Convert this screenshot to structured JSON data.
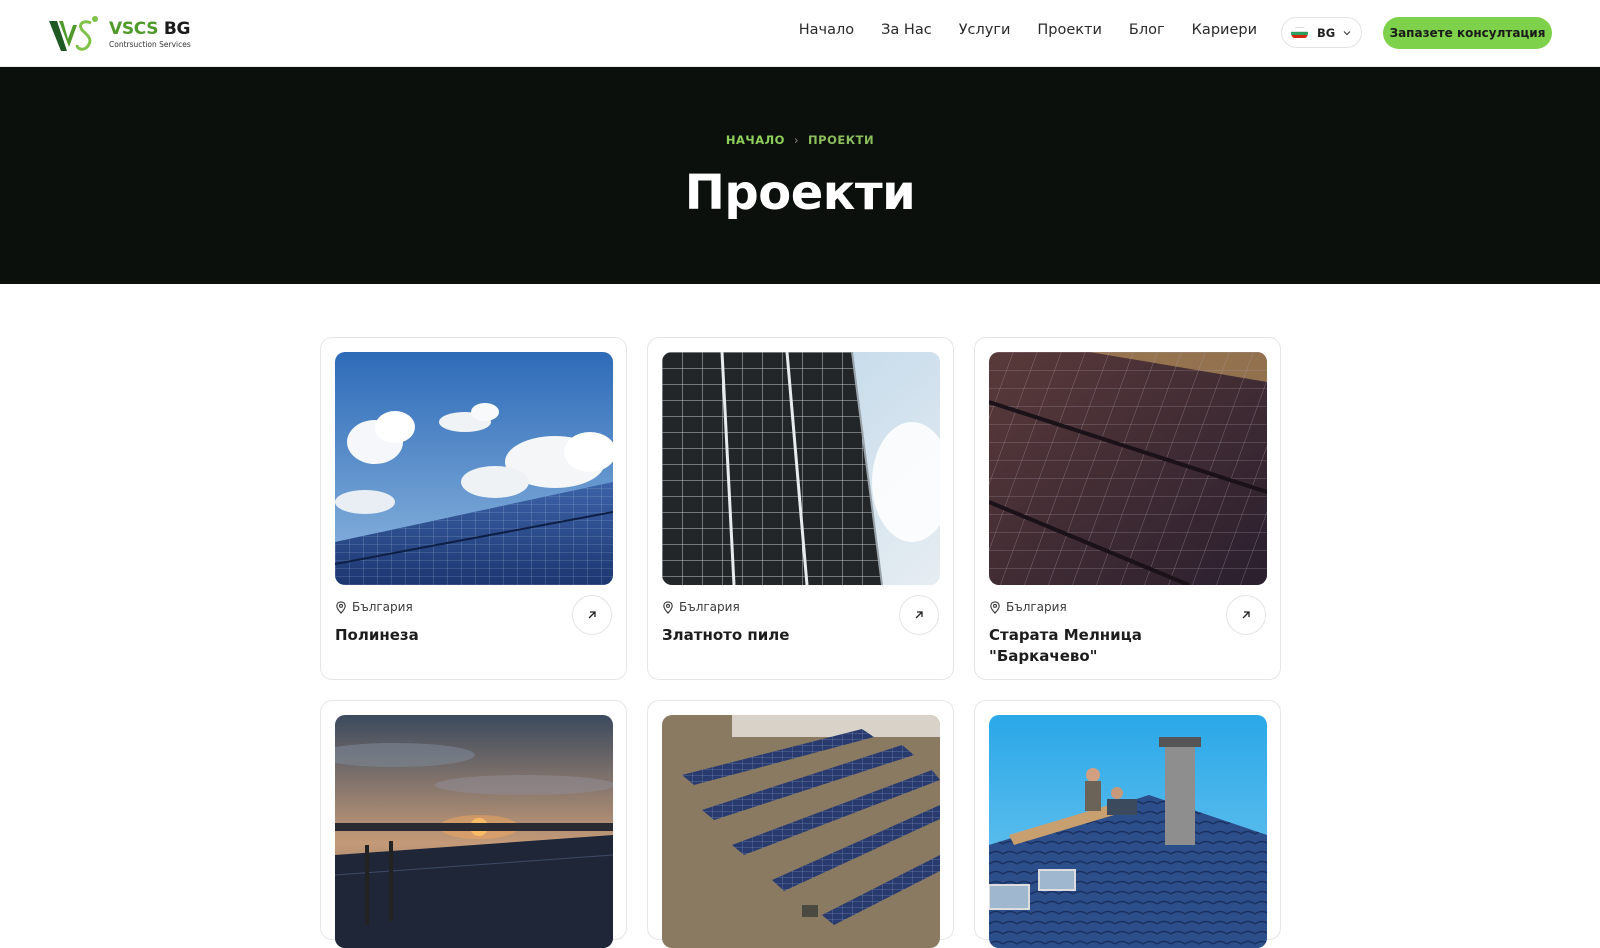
{
  "header": {
    "logo": {
      "brand_prefix": "VSCS",
      "brand_suffix": " BG",
      "subtitle": "Contrsuction Services"
    },
    "nav": [
      "Начало",
      "За Нас",
      "Услуги",
      "Проекти",
      "Блог",
      "Кариери"
    ],
    "language": {
      "code": "BG",
      "icon": "bulgaria-flag-icon"
    },
    "cta_label": "Запазете консултация"
  },
  "hero": {
    "breadcrumb": {
      "home": "НАЧАЛО",
      "current": "ПРОЕКТИ"
    },
    "title": "Проекти"
  },
  "projects": [
    {
      "location": "България",
      "title": "Полинеза",
      "image": "solar panels under blue cloudy sky"
    },
    {
      "location": "България",
      "title": "Златното пиле",
      "image": "rooftop solar panels against sky"
    },
    {
      "location": "България",
      "title": "Старата Мелница \"Баркачево\"",
      "image": "rooftop solar panels close-up"
    },
    {
      "location": "",
      "title": "",
      "image": "solar field at sunset"
    },
    {
      "location": "",
      "title": "",
      "image": "aerial view of solar rows on ground"
    },
    {
      "location": "",
      "title": "",
      "image": "workers on roof with chimney"
    }
  ],
  "colors": {
    "accent": "#7ed14a",
    "hero_bg": "#0c100d"
  }
}
